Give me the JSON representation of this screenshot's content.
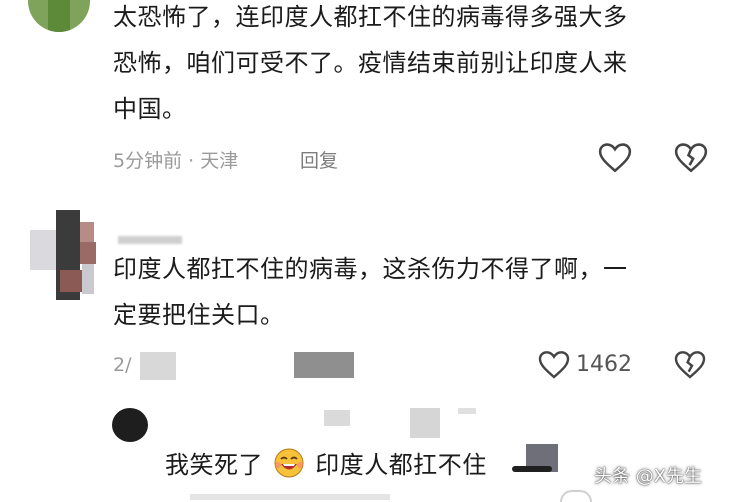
{
  "comments": [
    {
      "text_lines": [
        "太恐怖了，连印度人都扛不住的病毒得多强大多",
        "恐怖，咱们可受不了。疫情结束前别让印度人来",
        "中国。"
      ],
      "meta": "5分钟前 · 天津",
      "reply_label": "回复"
    },
    {
      "text_lines": [
        "印度人都扛不住的病毒，这杀伤力不得了啊，一",
        "定要把住关口。"
      ],
      "meta_partial": "2/",
      "like_count": "1462"
    },
    {
      "text_prefix": "我笑死了",
      "text_suffix": "印度人都扛不住"
    }
  ],
  "watermark": "头条 @X先生",
  "icons": [
    "heart-icon",
    "broken-heart-icon",
    "laughing-emoji-icon"
  ],
  "colors": {
    "accent": "#888888",
    "text": "#1b1b1b",
    "meta": "#9a9a9a"
  }
}
